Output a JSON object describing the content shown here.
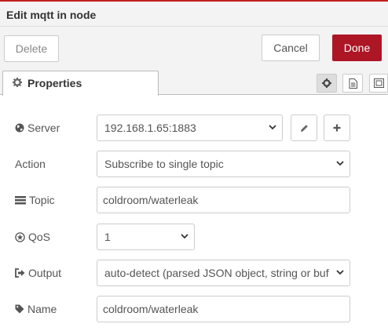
{
  "dialog": {
    "title": "Edit mqtt in node",
    "delete_label": "Delete",
    "cancel_label": "Cancel",
    "done_label": "Done"
  },
  "tabs": {
    "properties_label": "Properties"
  },
  "form": {
    "server": {
      "label": "Server",
      "value": "192.168.1.65:1883"
    },
    "action": {
      "label": "Action",
      "value": "Subscribe to single topic"
    },
    "topic": {
      "label": "Topic",
      "value": "coldroom/waterleak"
    },
    "qos": {
      "label": "QoS",
      "value": "1"
    },
    "output": {
      "label": "Output",
      "value": "auto-detect (parsed JSON object, string or buffer)"
    },
    "name": {
      "label": "Name",
      "value": "coldroom/waterleak"
    }
  },
  "colors": {
    "accent_bar": "#c02020",
    "done_button": "#ad1625"
  },
  "icons": [
    "gear-icon",
    "globe-icon",
    "tasks-icon",
    "qos-icon",
    "sign-out-icon",
    "tag-icon",
    "pencil-icon",
    "plus-icon",
    "file-icon",
    "frame-icon",
    "chevron-down-icon"
  ]
}
